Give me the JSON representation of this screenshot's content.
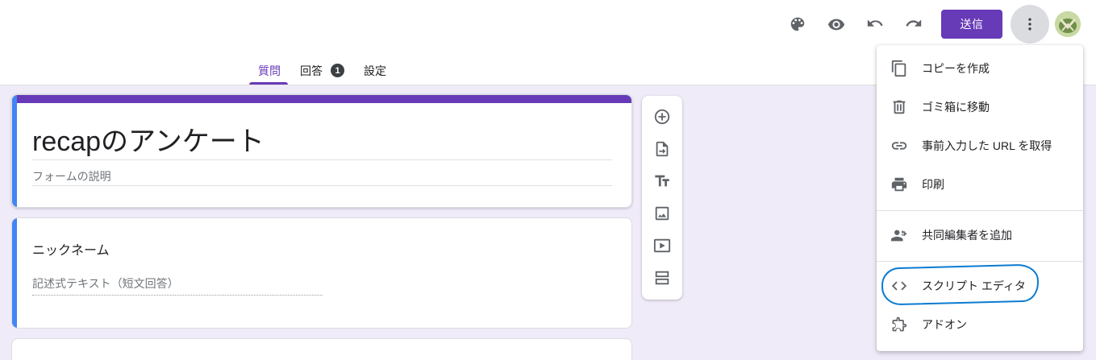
{
  "header": {
    "send_label": "送信",
    "icons": [
      "palette-icon",
      "eye-icon",
      "undo-icon",
      "redo-icon",
      "more-vert-icon"
    ]
  },
  "tabs": [
    {
      "label": "質問",
      "active": true
    },
    {
      "label": "回答",
      "badge": "1"
    },
    {
      "label": "設定"
    }
  ],
  "form": {
    "title": "recapのアンケート",
    "description_placeholder": "フォームの説明"
  },
  "question": {
    "title": "ニックネーム",
    "answer_hint": "記述式テキスト（短文回答）"
  },
  "toolbar": [
    "add-question-icon",
    "import-questions-icon",
    "add-title-icon",
    "add-image-icon",
    "add-video-icon",
    "add-section-icon"
  ],
  "menu": {
    "items": [
      {
        "label": "コピーを作成",
        "icon": "copy-icon"
      },
      {
        "label": "ゴミ箱に移動",
        "icon": "trash-icon"
      },
      {
        "label": "事前入力した URL を取得",
        "icon": "link-icon"
      },
      {
        "label": "印刷",
        "icon": "print-icon"
      },
      {
        "label": "共同編集者を追加",
        "icon": "add-people-icon"
      },
      {
        "label": "スクリプト エディタ",
        "icon": "code-icon"
      },
      {
        "label": "アドオン",
        "icon": "puzzle-icon"
      }
    ]
  },
  "colors": {
    "accent": "#673ab7",
    "background": "#f0ebf8",
    "question_indicator": "#4285f4",
    "annotation": "#0a7bd0"
  }
}
